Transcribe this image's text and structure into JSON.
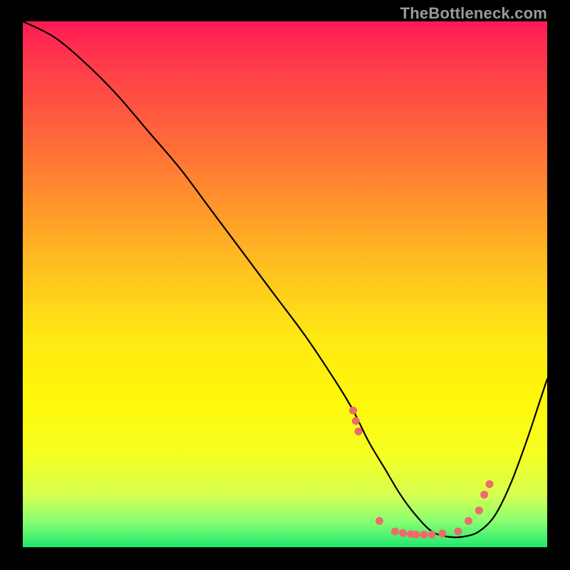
{
  "watermark": "TheBottleneck.com",
  "chart_data": {
    "type": "line",
    "title": "",
    "xlabel": "",
    "ylabel": "",
    "xlim": [
      0,
      100
    ],
    "ylim": [
      0,
      100
    ],
    "series": [
      {
        "name": "curve",
        "x": [
          0,
          6,
          12,
          18,
          24,
          30,
          36,
          42,
          48,
          54,
          60,
          63,
          66,
          69,
          72,
          75,
          78,
          81,
          84,
          87,
          90,
          93,
          96,
          99,
          100
        ],
        "y": [
          100,
          97,
          92,
          86,
          79,
          72,
          64,
          56,
          48,
          40,
          31,
          26,
          20,
          15,
          10,
          6,
          3,
          2,
          2,
          3,
          6,
          12,
          20,
          29,
          32
        ]
      }
    ],
    "markers": {
      "name": "highlight-dots",
      "color": "#ed6b6b",
      "x": [
        63,
        63.5,
        64,
        68,
        71,
        72.5,
        74,
        75,
        76.5,
        78,
        80,
        83,
        85,
        87,
        88,
        89
      ],
      "y": [
        26,
        24,
        22,
        5,
        3,
        2.7,
        2.5,
        2.4,
        2.4,
        2.4,
        2.6,
        3,
        5,
        7,
        10,
        12
      ]
    }
  }
}
